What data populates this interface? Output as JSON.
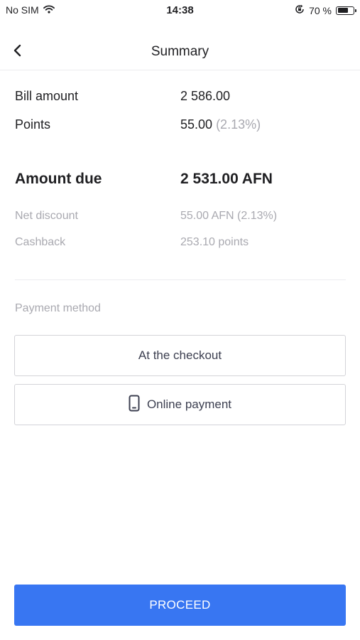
{
  "status_bar": {
    "carrier": "No SIM",
    "time": "14:38",
    "battery_percent_text": "70 %",
    "battery_level": 0.7,
    "icons": [
      "wifi-icon",
      "orientation-lock-icon",
      "battery-icon"
    ]
  },
  "nav": {
    "title": "Summary",
    "back_icon": "chevron-left-icon"
  },
  "summary": {
    "bill_amount_label": "Bill amount",
    "bill_amount_value": "2 586.00",
    "points_label": "Points",
    "points_value": "55.00",
    "points_percent": "(2.13%)",
    "amount_due_label": "Amount due",
    "amount_due_value": "2 531.00 AFN",
    "net_discount_label": "Net discount",
    "net_discount_value": "55.00 AFN (2.13%)",
    "cashback_label": "Cashback",
    "cashback_value": "253.10 points"
  },
  "payment": {
    "section_label": "Payment method",
    "options": [
      {
        "label": "At the checkout"
      },
      {
        "label": "Online payment",
        "icon": "phone-icon"
      }
    ]
  },
  "proceed_label": "PROCEED",
  "colors": {
    "accent": "#3876f2",
    "muted_text": "#a9a9b0",
    "primary_text": "#1f1f22"
  }
}
